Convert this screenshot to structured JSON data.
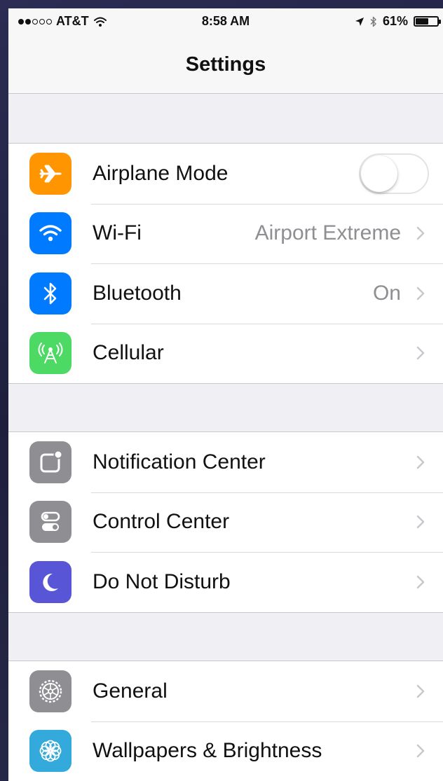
{
  "status_bar": {
    "carrier": "AT&T",
    "time": "8:58 AM",
    "battery_percent": "61%",
    "battery_level": 0.61,
    "signal_bars_filled": 2,
    "signal_bars_total": 5,
    "icons": [
      "signal-dots-icon",
      "wifi-icon",
      "location-arrow-icon",
      "bluetooth-icon",
      "battery-icon"
    ]
  },
  "nav": {
    "title": "Settings"
  },
  "groups": [
    {
      "rows": [
        {
          "label": "Airplane Mode",
          "icon": "airplane-icon",
          "color": "#ff9500",
          "toggle": false
        },
        {
          "label": "Wi-Fi",
          "icon": "wifi-icon",
          "color": "#007aff",
          "detail": "Airport Extreme"
        },
        {
          "label": "Bluetooth",
          "icon": "bluetooth-icon",
          "color": "#007aff",
          "detail": "On"
        },
        {
          "label": "Cellular",
          "icon": "cellular-antenna-icon",
          "color": "#4cd964",
          "detail": ""
        }
      ]
    },
    {
      "rows": [
        {
          "label": "Notification Center",
          "icon": "notification-center-icon",
          "color": "#8e8e93"
        },
        {
          "label": "Control Center",
          "icon": "control-center-icon",
          "color": "#8e8e93"
        },
        {
          "label": "Do Not Disturb",
          "icon": "moon-icon",
          "color": "#5856d6"
        }
      ]
    },
    {
      "rows": [
        {
          "label": "General",
          "icon": "gear-icon",
          "color": "#8e8e93"
        },
        {
          "label": "Wallpapers & Brightness",
          "icon": "wallpaper-flower-icon",
          "color": "#34aadc"
        }
      ]
    }
  ]
}
